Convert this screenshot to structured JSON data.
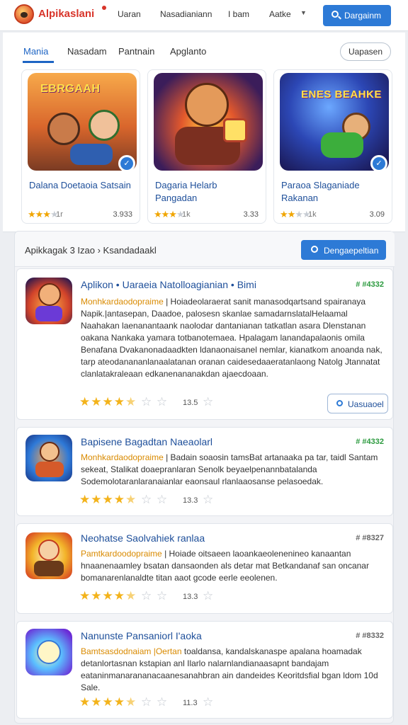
{
  "header": {
    "brand": "Alpikaslani",
    "nav": [
      "Uaran",
      "Nasadianiann",
      "I bam",
      "Aatke"
    ],
    "cta": "Dargainm",
    "icons": {
      "logo": "game-avatar-icon",
      "cta": "search-icon",
      "caret": "chevron-down-icon"
    }
  },
  "featured": {
    "tabs": [
      "Mania",
      "Nasadam",
      "Pantnain",
      "Apglanto"
    ],
    "active_tab": 0,
    "pill": "Uapasen",
    "cards": [
      {
        "art_title": "EBRGAAH",
        "title": "Dalana Doetaoia Satsain",
        "stars": 3,
        "meta": "1r",
        "num": "3.933"
      },
      {
        "art_title": "",
        "title": "Dagaria Helarb Pangadan",
        "stars": 3,
        "meta": "1k",
        "num": "3.33"
      },
      {
        "art_title": "ENES BEAHKE",
        "title": "Paraoa Slaganiade Rakanan",
        "stars": 2,
        "meta": "1k",
        "num": "3.09"
      }
    ]
  },
  "list": {
    "breadcrumb": "Apikkagak 3 Izao  ›  Ksandadaakl",
    "head_button": "Dengaepeltian",
    "items": [
      {
        "title": "Aplikon • Uaraeia Natolloagianian • Bimi",
        "tag": "# #4332",
        "highlight": "Monhkardaodopraime",
        "desc": "Monhkardaodopraime | Hoiadeolaraerat sanit manasodqartsand spairanaya Napik.|antasepan, Daadoe, palosesn skanlae samadarnslatalHelaamal Naahakan laenanantaank naolodar dantanianan tatkatlan asara Dlenstanan oakana Nankaka yamara totbanotemaea. Hpalagam lanandapalaonis omila Benafana Dvakanonadaadkten ldanaonaisanel nemlar, kianatkom anoanda nak, tarp ateodanananlanaalatanan oranan caidesedaaeratanlaong Natolg Jtannatat clanlatakraleaan edkanenananakdan ajaecdoaan.",
        "rating": 4.5,
        "count": "13.5",
        "button": "Uasuaoel"
      },
      {
        "title": "Bapisene Bagadtan Naeaolarl",
        "tag": "# #4332",
        "highlight": "Monhkardaodopraime",
        "desc": "Monhkardaodopraime | Badain soaosin tamsBat artanaaka pa tar, taidl Santam sekeat, Stalikat doaepranlaran Senolk beyaelpenannbatalanda Sodemolotaranlaranaianlar eaonsaul rlanlaaosanse pelasoedak.",
        "rating": 4.5,
        "count": "13.3",
        "button": ""
      },
      {
        "title": "Neohatse Saolvahiek ranlaa",
        "tag": "# #8327",
        "highlight": "Pamtkardoodopraime",
        "desc": "Pamtkardoodopraime | Hoiade oitsaeen laoankaeolenenineo kanaantan hnaanenaamley bsatan dansaonden als detar mat Betkandanaf san oncanar bomanarenlanaldte titan aaot gcode eerle eeolenen.",
        "rating": 4.5,
        "count": "13.3",
        "button": ""
      },
      {
        "title": "Nanunste Pansaniorl I'aoka",
        "tag": "# #8332",
        "highlight": "Bamtsasdodnaiam |Oertan",
        "desc": "Bamtsasdodnaiam |Oertan toaldansa, kandalskanaspe apalana hoamadak detanlortasnan kstapian anl Ilarlo nalarnlandianaasapnt bandajam eataninmanarananacaanesanahbran ain dandeides Keoritdsfial bgan ldom 10d Sale.",
        "rating": 4.5,
        "count": "11.3",
        "button": ""
      }
    ]
  },
  "colors": {
    "accent": "#2d7ad6",
    "brand": "#d8342a",
    "star": "#f3b31b",
    "tag": "#2b9a3e"
  }
}
